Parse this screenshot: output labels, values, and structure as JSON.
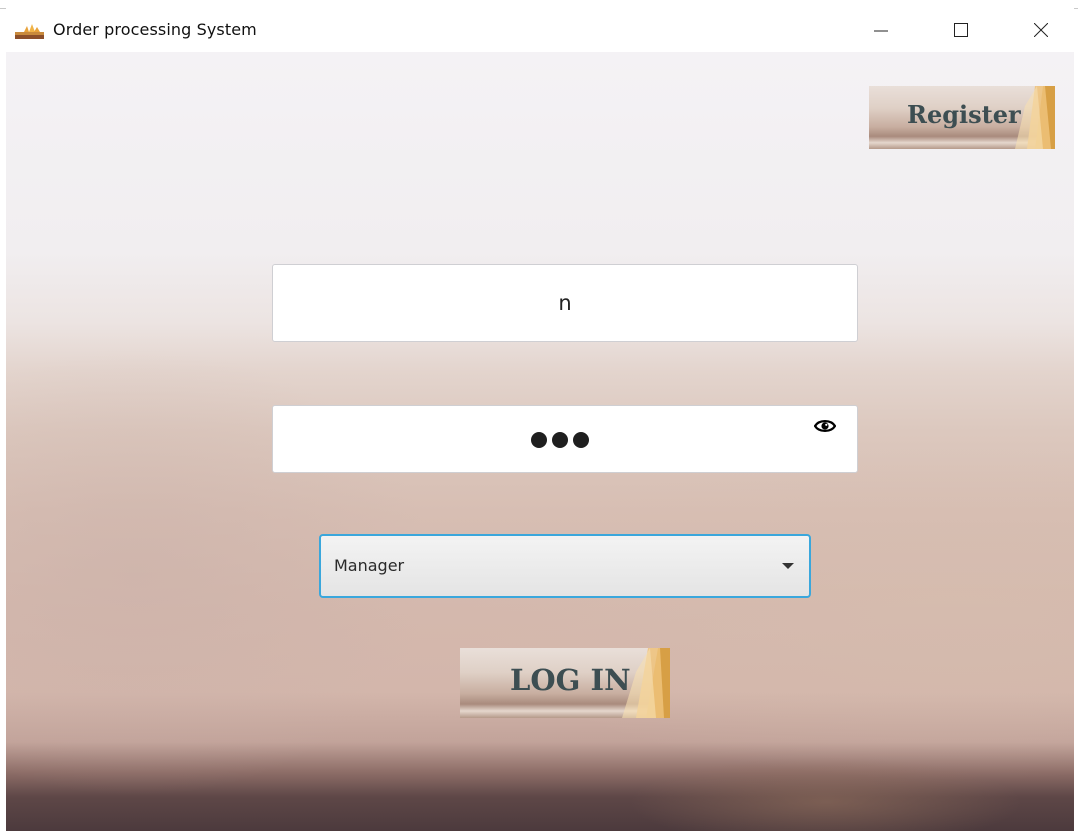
{
  "window": {
    "title": "Order processing System",
    "controls": {
      "minimize_icon": "minimize-icon",
      "maximize_icon": "maximize-icon",
      "close_icon": "close-icon"
    }
  },
  "header": {
    "register_label": "Register"
  },
  "login_form": {
    "username_value": "n",
    "password_masked_length": 3,
    "password_dots": "●●●",
    "show_password_icon": "eye-icon",
    "role": {
      "selected": "Manager"
    },
    "login_label": "LOG IN"
  },
  "colors": {
    "button_text": "#3d4e52",
    "select_focus_border": "#3aa7dc",
    "book_page_accent": "#d9a64a"
  }
}
